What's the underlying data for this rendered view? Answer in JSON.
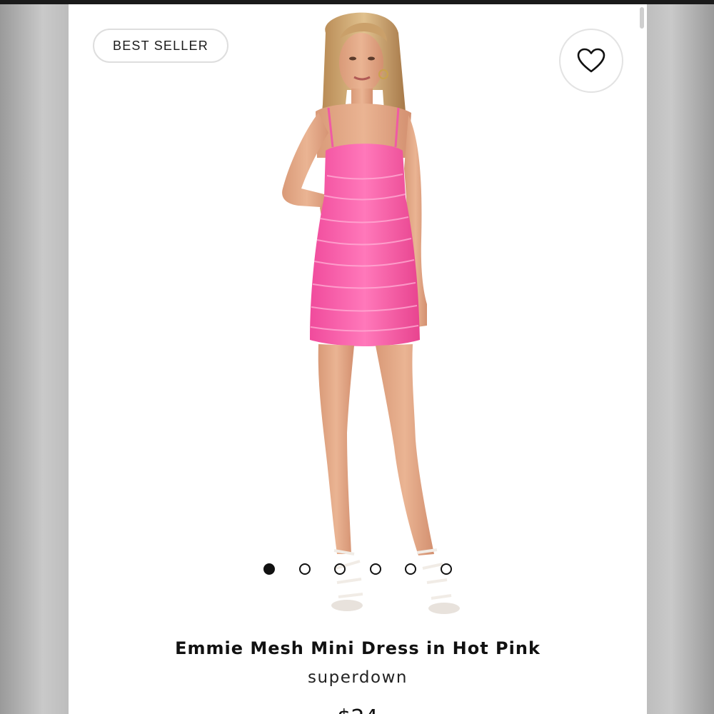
{
  "badge": {
    "label": "BEST SELLER"
  },
  "favorite": {
    "icon": "heart-outline-icon"
  },
  "gallery": {
    "image_description": "model-wearing-hot-pink-ruched-mesh-mini-dress",
    "slide_count": 6,
    "active_slide": 1
  },
  "product": {
    "name": "Emmie Mesh Mini Dress in Hot Pink",
    "brand": "superdown",
    "price_partial": "$24"
  },
  "colors": {
    "dress": "#f55aa8",
    "accent_dark": "#111111",
    "badge_border": "#dedede"
  }
}
